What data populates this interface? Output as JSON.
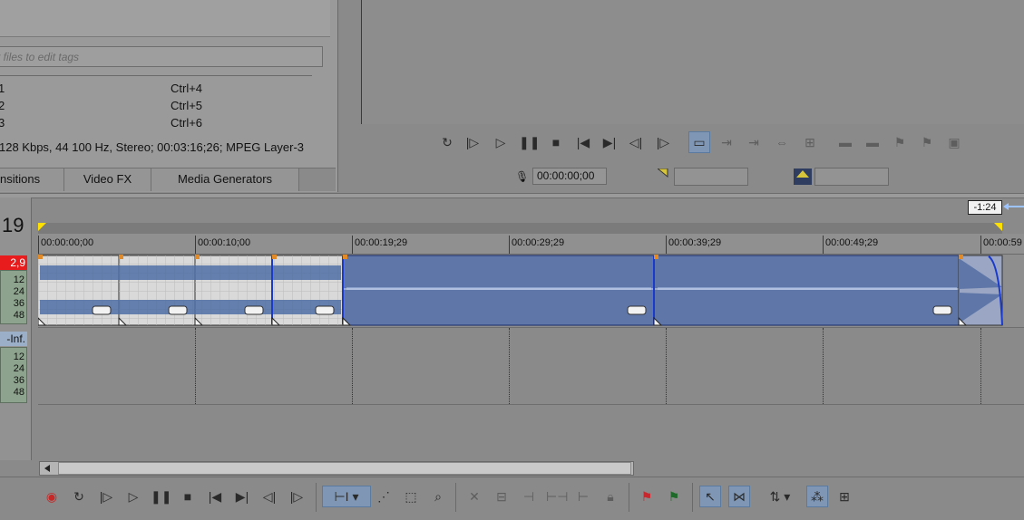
{
  "explorer": {
    "tag_placeholder": "t files to edit tags",
    "tags": [
      {
        "label": "1",
        "shortcut": "Ctrl+4"
      },
      {
        "label": "2",
        "shortcut": "Ctrl+5"
      },
      {
        "label": "3",
        "shortcut": "Ctrl+6"
      }
    ],
    "media_info": "128 Kbps, 44 100 Hz, Stereo; 00:03:16;26; MPEG Layer-3",
    "tabs": [
      "nsitions",
      "Video FX",
      "Media Generators"
    ]
  },
  "preview": {
    "timecode": "00:00:00;00"
  },
  "timeline": {
    "frame_number": "19",
    "end_badge": "-1:24",
    "ruler_labels": [
      "00:00:00;00",
      "00:00:10;00",
      "00:00:19;29",
      "00:00:29;29",
      "00:00:39;29",
      "00:00:49;29",
      "00:00:59"
    ],
    "track1_peak": "2,9",
    "track2_peak": "-Inf.",
    "meter_ticks": [
      "12",
      "24",
      "36",
      "48"
    ]
  },
  "icons": {
    "loop": "loop-icon",
    "play_from_start": "play-from-start-icon",
    "play": "play-icon",
    "pause": "pause-icon",
    "stop": "stop-icon",
    "prev": "go-to-start-icon",
    "next": "go-to-end-icon",
    "prev_frame": "previous-frame-icon",
    "next_frame": "next-frame-icon",
    "record": "record-icon"
  },
  "colors": {
    "selected_clip": "#5f76a8",
    "clip": "#d9d9d9",
    "waveform": "#4f6da4",
    "peak_red": "#e81c1c",
    "marker_orange": "#e08a2a"
  }
}
